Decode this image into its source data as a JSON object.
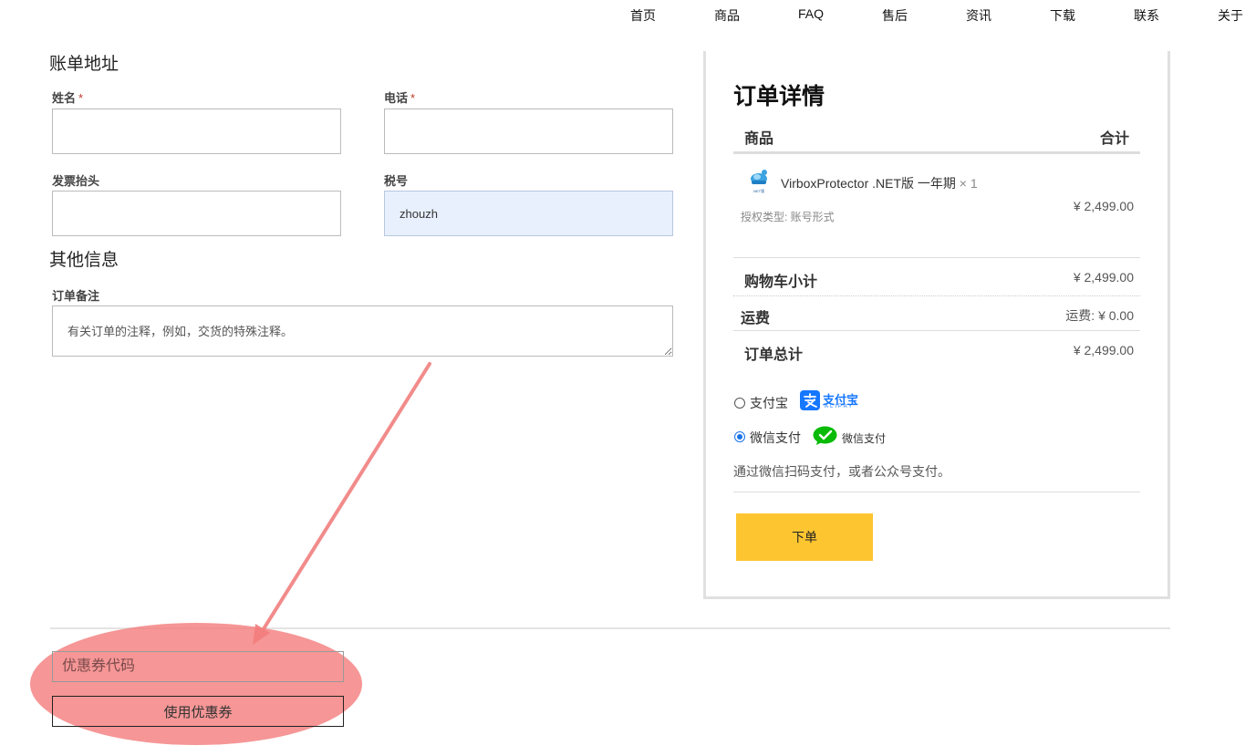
{
  "nav": {
    "items": [
      "首页",
      "商品",
      "FAQ",
      "售后",
      "资讯",
      "下载",
      "联系",
      "关于"
    ]
  },
  "billing": {
    "title": "账单地址",
    "name_label": "姓名",
    "phone_label": "电话",
    "required_mark": "*",
    "invoice_title_label": "发票抬头",
    "tax_id_label": "税号",
    "name_value": "",
    "phone_value": "",
    "invoice_title_value": "",
    "tax_id_value": "zhouzh"
  },
  "other": {
    "title": "其他信息",
    "notes_label": "订单备注",
    "notes_placeholder": "有关订单的注释，例如，交货的特殊注释。"
  },
  "order": {
    "title": "订单详情",
    "col_product": "商品",
    "col_total": "合计",
    "product_name": "VirboxProtector .NET版 一年期",
    "product_qty": "× 1",
    "product_icon_text": ".NET版",
    "license_type": "授权类型: 账号形式",
    "product_price": "¥ 2,499.00",
    "subtotal_label": "购物车小计",
    "subtotal_value": "¥ 2,499.00",
    "shipping_label": "运费",
    "shipping_value": "运费: ¥ 0.00",
    "total_label": "订单总计",
    "total_value": "¥ 2,499.00"
  },
  "payment": {
    "alipay_label": "支付宝",
    "alipay_logo_cn": "支付宝",
    "alipay_logo_en": "ALIPAY",
    "wechat_label": "微信支付",
    "wechat_logo_text": "微信支付",
    "selected": "wechat",
    "description": "通过微信扫码支付，或者公众号支付。",
    "place_order": "下单",
    "colors": {
      "alipay": "#1677ff",
      "wechat": "#09bb07",
      "button": "#fdc530"
    }
  },
  "coupon": {
    "placeholder": "优惠券代码",
    "apply_label": "使用优惠券"
  },
  "annotation": {
    "color": "#f47c7c"
  }
}
